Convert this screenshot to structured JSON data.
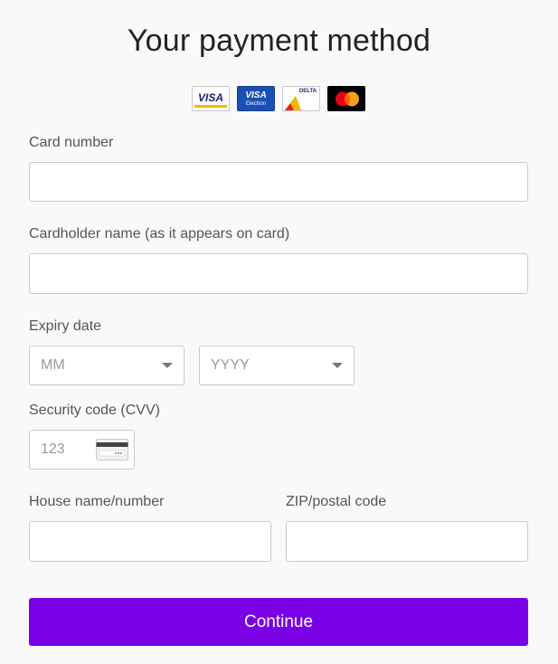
{
  "title": "Your payment method",
  "card_logos": [
    {
      "name": "VISA"
    },
    {
      "name": "VISA",
      "sub": "Electron"
    },
    {
      "name": "DELTA"
    },
    {
      "name": "mastercard"
    }
  ],
  "fields": {
    "card_number": {
      "label": "Card number",
      "value": "",
      "placeholder": ""
    },
    "cardholder_name": {
      "label": "Cardholder name (as it appears on card)",
      "value": "",
      "placeholder": ""
    },
    "expiry": {
      "label": "Expiry date",
      "month_placeholder": "MM",
      "year_placeholder": "YYYY"
    },
    "cvv": {
      "label": "Security code (CVV)",
      "placeholder": "123"
    },
    "house": {
      "label": "House name/number",
      "value": "",
      "placeholder": ""
    },
    "zip": {
      "label": "ZIP/postal code",
      "value": "",
      "placeholder": ""
    }
  },
  "button": {
    "continue_label": "Continue"
  },
  "colors": {
    "accent": "#7a00e6",
    "background": "#f9f9f9",
    "border": "#c9c9c9"
  }
}
